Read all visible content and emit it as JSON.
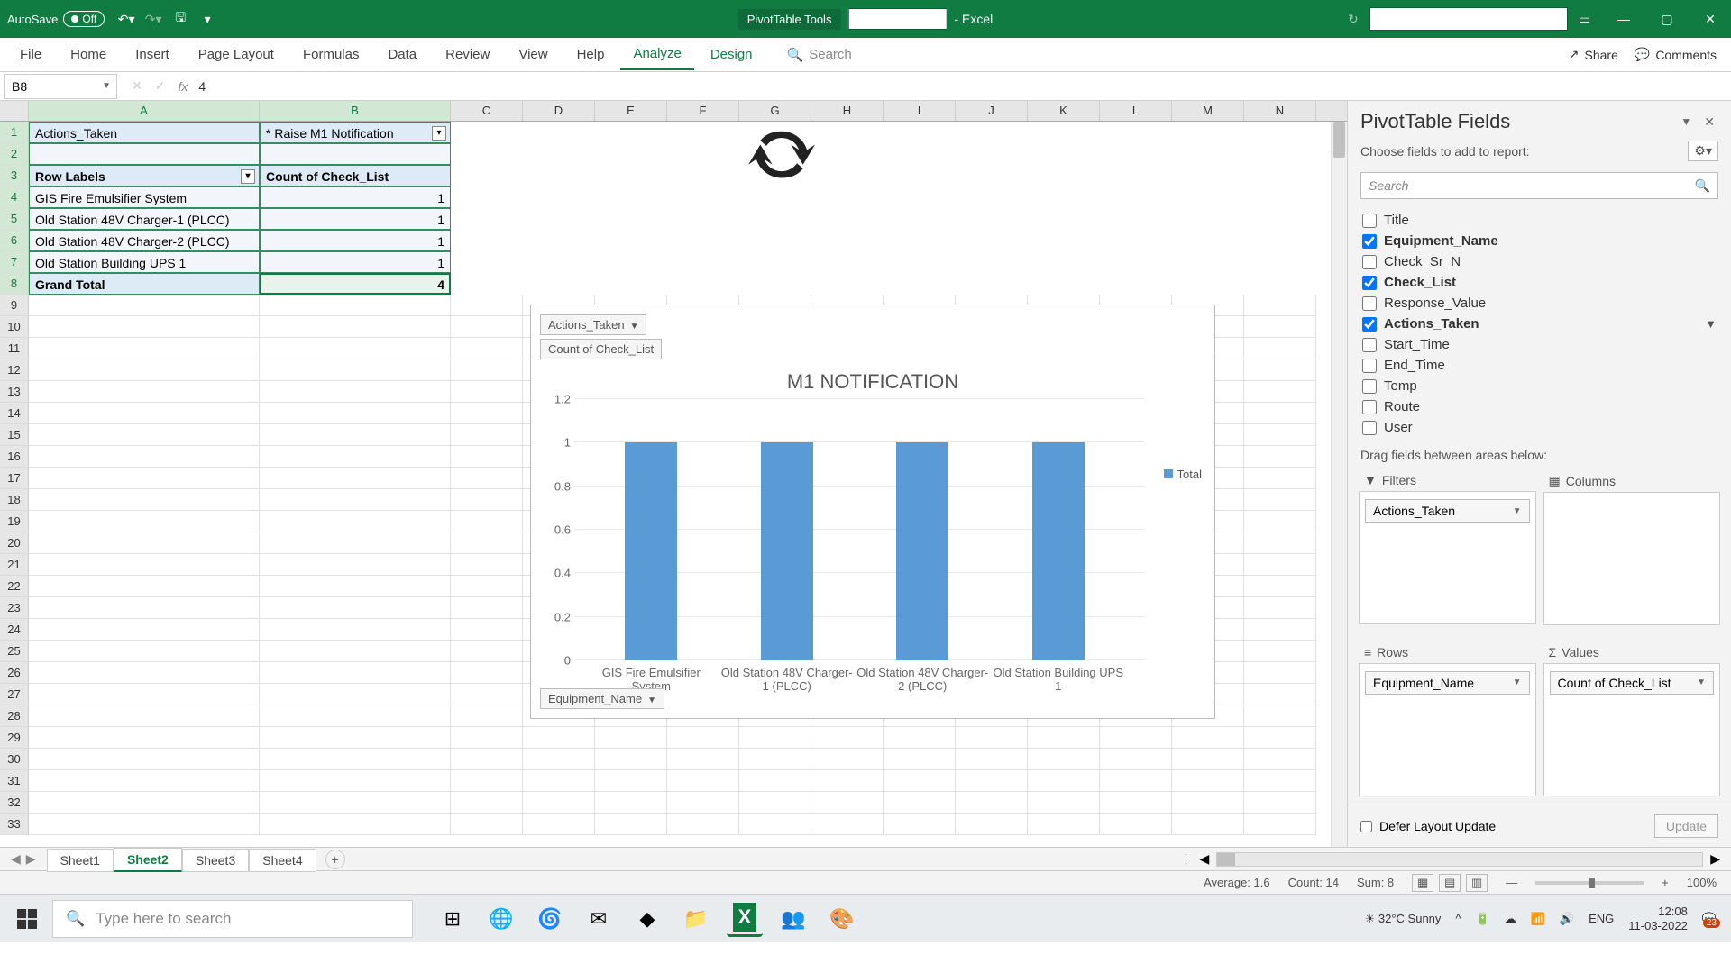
{
  "title_bar": {
    "autosave_label": "AutoSave",
    "autosave_state": "Off",
    "pivot_tools": "PivotTable Tools",
    "app_suffix": "-  Excel"
  },
  "ribbon": {
    "tabs": [
      "File",
      "Home",
      "Insert",
      "Page Layout",
      "Formulas",
      "Data",
      "Review",
      "View",
      "Help",
      "Analyze",
      "Design"
    ],
    "active": "Analyze",
    "search_placeholder": "Search",
    "share": "Share",
    "comments": "Comments"
  },
  "formula_bar": {
    "name_box": "B8",
    "value": "4"
  },
  "pivot": {
    "filter_field": "Actions_Taken",
    "filter_value": "* Raise M1 Notification",
    "row_labels_header": "Row Labels",
    "values_header": "Count of Check_List",
    "rows": [
      {
        "label": "GIS Fire Emulsifier System",
        "value": 1
      },
      {
        "label": "Old Station 48V Charger-1 (PLCC)",
        "value": 1
      },
      {
        "label": "Old Station 48V Charger-2 (PLCC)",
        "value": 1
      },
      {
        "label": "Old Station Building UPS 1",
        "value": 1
      }
    ],
    "grand_label": "Grand Total",
    "grand_value": 4,
    "selected_cell": "B8"
  },
  "columns": [
    "A",
    "B",
    "C",
    "D",
    "E",
    "F",
    "G",
    "H",
    "I",
    "J",
    "K",
    "L",
    "M",
    "N"
  ],
  "row_count": 33,
  "chart_data": {
    "type": "bar",
    "title": "M1 NOTIFICATION",
    "filter_button": "Actions_Taken",
    "value_button": "Count of Check_List",
    "axis_button": "Equipment_Name",
    "categories": [
      "GIS Fire Emulsifier System",
      "Old Station 48V Charger-1 (PLCC)",
      "Old Station 48V Charger-2 (PLCC)",
      "Old Station Building UPS 1"
    ],
    "values": [
      1,
      1,
      1,
      1
    ],
    "y_ticks": [
      0,
      0.2,
      0.4,
      0.6,
      0.8,
      1,
      1.2
    ],
    "ylim": [
      0,
      1.2
    ],
    "legend": "Total",
    "series_color": "#5b9bd5"
  },
  "fields_pane": {
    "title": "PivotTable Fields",
    "subtitle": "Choose fields to add to report:",
    "search_placeholder": "Search",
    "fields": [
      {
        "name": "Title",
        "checked": false
      },
      {
        "name": "Equipment_Name",
        "checked": true
      },
      {
        "name": "Check_Sr_N",
        "checked": false
      },
      {
        "name": "Check_List",
        "checked": true
      },
      {
        "name": "Response_Value",
        "checked": false
      },
      {
        "name": "Actions_Taken",
        "checked": true,
        "filtered": true
      },
      {
        "name": "Start_Time",
        "checked": false
      },
      {
        "name": "End_Time",
        "checked": false
      },
      {
        "name": "Temp",
        "checked": false
      },
      {
        "name": "Route",
        "checked": false
      },
      {
        "name": "User",
        "checked": false
      }
    ],
    "drag_label": "Drag fields between areas below:",
    "areas": {
      "filters_label": "Filters",
      "filters": [
        "Actions_Taken"
      ],
      "columns_label": "Columns",
      "columns": [],
      "rows_label": "Rows",
      "rows": [
        "Equipment_Name"
      ],
      "values_label": "Values",
      "values": [
        "Count of Check_List"
      ]
    },
    "defer_label": "Defer Layout Update",
    "update_label": "Update"
  },
  "sheet_tabs": {
    "tabs": [
      "Sheet1",
      "Sheet2",
      "Sheet3",
      "Sheet4"
    ],
    "active": "Sheet2"
  },
  "status_bar": {
    "avg": "Average: 1.6",
    "count": "Count: 14",
    "sum": "Sum: 8",
    "zoom": "100%"
  },
  "taskbar": {
    "search_placeholder": "Type here to search",
    "weather": "32°C Sunny",
    "lang": "ENG",
    "time": "12:08",
    "date": "11-03-2022",
    "notif_count": "23"
  }
}
